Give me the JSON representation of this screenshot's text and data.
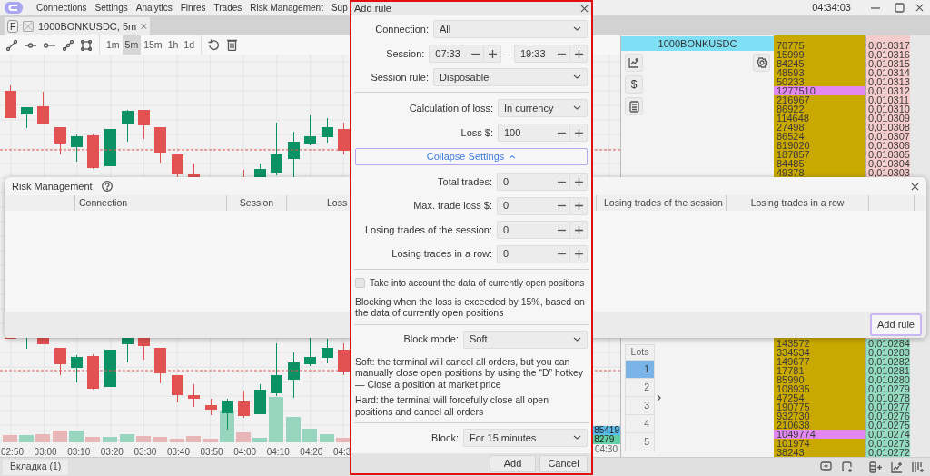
{
  "menu_bar": {
    "items": [
      "Connections",
      "Settings",
      "Analytics",
      "Finres",
      "Trades",
      "Risk Management",
      "Sup"
    ],
    "clock": "04:34:03"
  },
  "chart_tab": {
    "marker": "F",
    "title": "1000BONKUSDC, 5m"
  },
  "toolbar": {
    "timeframes": [
      {
        "label": "1m",
        "selected": false
      },
      {
        "label": "5m",
        "selected": true
      },
      {
        "label": "15m",
        "selected": false
      },
      {
        "label": "1h",
        "selected": false
      },
      {
        "label": "1d",
        "selected": false
      }
    ]
  },
  "chart": {
    "time_labels": [
      "02:50",
      "03:00",
      "03:10",
      "03:20",
      "03:30",
      "03:40",
      "03:50",
      "04:00",
      "04:10",
      "04:20",
      "04:3"
    ],
    "last_time_label": "04:30",
    "price_tags": [
      {
        "text": "85419",
        "color": "#5bbbe8"
      },
      {
        "text": "8279",
        "color": "#62cfa6"
      }
    ]
  },
  "order_book": {
    "symbol": "1000BONKUSDC",
    "currency_button": "$",
    "asks": [
      {
        "volume": "70775",
        "price": "0,010317",
        "highlighted": false
      },
      {
        "volume": "15999",
        "price": "0,010316",
        "highlighted": false
      },
      {
        "volume": "84245",
        "price": "0,010315",
        "highlighted": false
      },
      {
        "volume": "48593",
        "price": "0,010314",
        "highlighted": false
      },
      {
        "volume": "50233",
        "price": "0,010313",
        "highlighted": false
      },
      {
        "volume": "1277510",
        "price": "0,010312",
        "highlighted": true
      },
      {
        "volume": "216967",
        "price": "0,010311",
        "highlighted": false
      },
      {
        "volume": "86922",
        "price": "0,010310",
        "highlighted": false
      },
      {
        "volume": "114648",
        "price": "0,010309",
        "highlighted": false
      },
      {
        "volume": "27498",
        "price": "0,010308",
        "highlighted": false
      },
      {
        "volume": "86524",
        "price": "0,010307",
        "highlighted": false
      },
      {
        "volume": "819020",
        "price": "0,010306",
        "highlighted": false
      },
      {
        "volume": "187857",
        "price": "0,010305",
        "highlighted": false
      },
      {
        "volume": "84485",
        "price": "0,010304",
        "highlighted": false
      },
      {
        "volume": "49378",
        "price": "0,010303",
        "highlighted": false
      }
    ],
    "bids": [
      {
        "volume": "143572",
        "price": "0,010284",
        "highlighted": false
      },
      {
        "volume": "334534",
        "price": "0,010283",
        "highlighted": false
      },
      {
        "volume": "149677",
        "price": "0,010282",
        "highlighted": false
      },
      {
        "volume": "17781",
        "price": "0,010281",
        "highlighted": false
      },
      {
        "volume": "85990",
        "price": "0,010280",
        "highlighted": false
      },
      {
        "volume": "108935",
        "price": "0,010279",
        "highlighted": false
      },
      {
        "volume": "47254",
        "price": "0,010278",
        "highlighted": false
      },
      {
        "volume": "190775",
        "price": "0,010277",
        "highlighted": false
      },
      {
        "volume": "932730",
        "price": "0,010276",
        "highlighted": false
      },
      {
        "volume": "210638",
        "price": "0,010275",
        "highlighted": false
      },
      {
        "volume": "1049774",
        "price": "0,010274",
        "highlighted": true
      },
      {
        "volume": "101974",
        "price": "0,010273",
        "highlighted": false
      },
      {
        "volume": "38243",
        "price": "0,010272",
        "highlighted": false
      }
    ],
    "lots": {
      "header": "Lots",
      "items": [
        {
          "label": "1",
          "selected": true
        },
        {
          "label": "2",
          "selected": false
        },
        {
          "label": "3",
          "selected": false
        },
        {
          "label": "4",
          "selected": false
        },
        {
          "label": "5",
          "selected": false
        }
      ]
    }
  },
  "risk_management": {
    "title": "Risk Management",
    "columns": [
      "Connection",
      "Session",
      "Loss",
      "Losing trades of the session",
      "Losing trades in a row"
    ],
    "add_rule_button": "Add rule"
  },
  "add_rule_dialog": {
    "title": "Add rule",
    "connection": {
      "label": "Connection:",
      "value": "All"
    },
    "session": {
      "label": "Session:",
      "start": "07:33",
      "separator": "-",
      "end": "19:33"
    },
    "session_rule": {
      "label": "Session rule:",
      "value": "Disposable"
    },
    "loss_calculation": {
      "label": "Calculation of loss:",
      "value": "In currency"
    },
    "loss": {
      "label": "Loss $:",
      "value": "100"
    },
    "collapse_button": {
      "label": "Collapse Settings",
      "expanded": true
    },
    "limits": [
      {
        "label": "Total trades:",
        "value": "0"
      },
      {
        "label": "Max. trade loss $:",
        "value": "0"
      },
      {
        "label": "Losing trades of the session:",
        "value": "0"
      },
      {
        "label": "Losing trades in a row:",
        "value": "0"
      }
    ],
    "open_positions": {
      "label": "Take into account the data of currently open positions",
      "checked": false
    },
    "blocking_note": "Blocking when the loss is exceeded by 15%, based on the data of currently open positions",
    "block_mode": {
      "label": "Block mode:",
      "value": "Soft"
    },
    "soft_note": "Soft: the terminal will cancel all orders, but you can manually close open positions by using the “D” hotkey — Close a position at market price",
    "hard_note": "Hard: the terminal will forcefully close all open positions and cancel all orders",
    "block": {
      "label": "Block:",
      "value": "For 15 minutes"
    },
    "buttons": [
      "Add",
      "Cancel"
    ]
  },
  "status_bar": {
    "tab": "Вкладка (1)"
  }
}
